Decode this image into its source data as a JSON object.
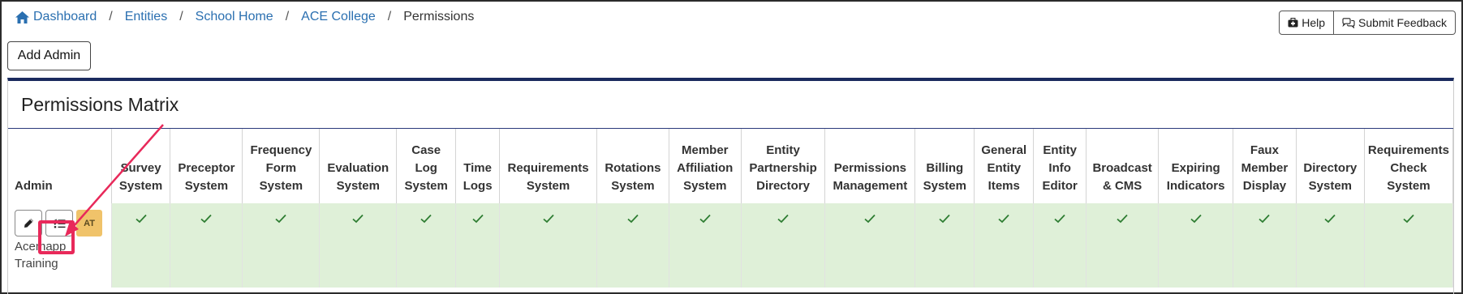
{
  "breadcrumb": {
    "items": [
      "Dashboard",
      "Entities",
      "School Home",
      "ACE College"
    ],
    "current": "Permissions",
    "separator": "/"
  },
  "header_buttons": {
    "help": "Help",
    "feedback": "Submit Feedback"
  },
  "add_admin_label": "Add Admin",
  "panel": {
    "title": "Permissions Matrix"
  },
  "matrix": {
    "admin_header": "Admin",
    "columns": [
      "Survey System",
      "Preceptor System",
      "Frequency Form System",
      "Evaluation System",
      "Case Log System",
      "Time Logs",
      "Requirements System",
      "Rotations System",
      "Member Affiliation System",
      "Entity Partnership Directory",
      "Permissions Management",
      "Billing System",
      "General Entity Items",
      "Entity Info Editor",
      "Broadcast & CMS",
      "Expiring Indicators",
      "Faux Member Display",
      "Directory System",
      "Requirements Check System"
    ],
    "rows": [
      {
        "admin_name": "Acemapp Training",
        "initials": "AT",
        "permissions": [
          true,
          true,
          true,
          true,
          true,
          true,
          true,
          true,
          true,
          true,
          true,
          true,
          true,
          true,
          true,
          true,
          true,
          true,
          true
        ]
      }
    ]
  },
  "colors": {
    "link": "#2a6fb0",
    "granted_bg": "#dff0d8",
    "check": "#2e7d32",
    "panel_border": "#1a2a5e",
    "avatar_bg": "#f0c36a",
    "highlight": "#e8295a"
  },
  "icons": {
    "home": "home-icon",
    "help": "first-aid-kit-icon",
    "feedback": "chat-bubbles-icon",
    "edit": "pencil-icon",
    "permissions": "checklist-icon",
    "granted": "checkmark-icon"
  }
}
